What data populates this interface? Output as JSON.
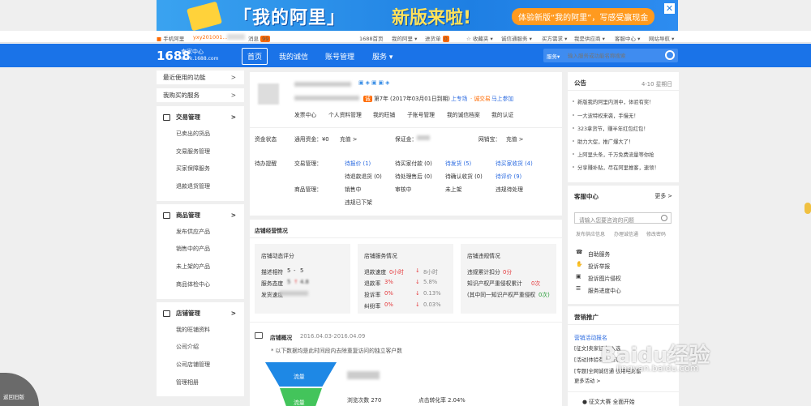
{
  "banner": {
    "title1": "「我的阿里」",
    "title2": "新版来啦!",
    "cta": "体验新版“我的阿里”，写感受赢现金",
    "close": "✕"
  },
  "topbar": {
    "mobile": "手机阿里",
    "user": "yxy201001...",
    "messages": "消息",
    "msg_count": "99",
    "links": [
      "1688首页",
      "我的阿里 ▾",
      "进货单",
      "☆ 收藏夹 ▾",
      "诚信通服务 ▾",
      "买方需求 ▾",
      "我是供应商 ▾",
      "客服中心 ▾",
      "网站导航 ▾"
    ],
    "cart_count": "0"
  },
  "nav": {
    "logo": "1688",
    "seller_center": "卖家中心",
    "domain": "work.1688.com",
    "items": [
      "首页",
      "我的诚信",
      "账号管理",
      "服务 ▾"
    ],
    "search_scope": "服务▾",
    "search_placeholder": "输入服务或功能名称搜索"
  },
  "sidebar": {
    "top_items": [
      {
        "label": "最近使用的功能"
      },
      {
        "label": "我购买的服务"
      }
    ],
    "groups": [
      {
        "title": "交易管理",
        "items": [
          "已卖出的货品",
          "交易服务管理",
          "买家保障服务",
          "退款退货管理"
        ]
      },
      {
        "title": "商品管理",
        "items": [
          "发布供应产品",
          "销售中的产品",
          "未上架的产品",
          "商品体检中心"
        ]
      },
      {
        "title": "店铺管理",
        "items": [
          "我的旺铺资料",
          "公司介绍",
          "公司店铺管理",
          "管理相册"
        ]
      }
    ]
  },
  "profile": {
    "years": "第7年 (2017年03月01日到期)",
    "upgrade": "上专场",
    "trade": "· 诚交易",
    "join": "马上参加",
    "links": [
      "发票中心",
      "个人资料管理",
      "我的旺铺",
      "子账号管理",
      "我的诚信档案",
      "我的认证"
    ]
  },
  "funds": {
    "label": "资金状态",
    "tongyong": "通用资金：¥0",
    "recharge": "充值 >",
    "deposit": "保证金：",
    "wangxiao": "网销宝：",
    "recharge2": "充值 >"
  },
  "todo": {
    "label": "待办提醒",
    "trade_label": "交易管理：",
    "goods_label": "商品管理：",
    "trade": [
      [
        "待报价 (1)",
        "待买家付款 (0)",
        "待发货 (5)",
        "待买家收货 (4)"
      ],
      [
        "待退款退货 (0)",
        "待处理售后 (0)",
        "待确认收货 (0)",
        "待评价 (9)"
      ]
    ],
    "goods": [
      [
        "销售中",
        "审核中",
        "未上架",
        "违规待处理"
      ],
      [
        "违规已下架"
      ]
    ]
  },
  "shop": {
    "title": "店铺经营情况",
    "dynamic": {
      "title": "店铺动态评分",
      "rows": [
        [
          "描述相符",
          "5",
          "-",
          "5"
        ],
        [
          "服务态度",
          "5",
          "↑",
          "4.8"
        ],
        [
          "发货速度",
          "",
          "",
          ""
        ]
      ]
    },
    "service": {
      "title": "店铺服务情况",
      "rows": [
        [
          "退款速度",
          "0小时",
          "↓",
          "8小时"
        ],
        [
          "退款率",
          "3%",
          "↓",
          "5.8%"
        ],
        [
          "投诉率",
          "0%",
          "↓",
          "0.13%"
        ],
        [
          "纠纷率",
          "0%",
          "↓",
          "0.03%"
        ]
      ]
    },
    "violation": {
      "title": "店铺违规情况",
      "rows": [
        [
          "违规累计扣分",
          "0分"
        ],
        [
          "知识产权严重侵权累计",
          "0次"
        ],
        [
          "(其中同一知识产权严重侵权",
          "0次)"
        ]
      ]
    },
    "overview_title": "店铺概况",
    "overview_range": "2016.04.03-2016.04.09",
    "overview_note": "* 以下数据均是此时间段内去除重复访问的独立客户数",
    "funnel_top": "流量",
    "funnel_bottom": "流量",
    "views": "浏览次数 270",
    "click_rate": "点击转化率 2.04%"
  },
  "announce": {
    "title": "公告",
    "date": "4-10 星期日",
    "items": [
      "新版我的阿里内测中，体验有奖！",
      "一大波特权来袭，手慢无！",
      "323拿货节，赚半年红包红包！",
      "助力大促，推广爆大了！",
      "上阿里头条，千万免费流量等你抢",
      "分享赚补贴，尽在阿里推客，速领！"
    ]
  },
  "service": {
    "title": "客服中心",
    "more": "更多 >",
    "search_placeholder": "请输入您要咨询的问题",
    "tags": [
      "发布供应信息",
      "办理诚信通",
      "修改密码"
    ],
    "items": [
      "自助服务",
      "投诉举报",
      "投诉图片侵权",
      "服务进度中心"
    ]
  },
  "promo": {
    "title": "营销推广",
    "sub": "营销活动报名",
    "items": [
      "[征文]卖家征文 入选",
      "[活动]体验有礼 新功",
      "[专题]全网诚信通 很用电财富"
    ],
    "more": "更多活动 >",
    "contest": "征文大赛 全面开始"
  },
  "oldversion": "返回旧版",
  "watermark": "Baidu经验",
  "watermark2": "jingyan.baidu.com",
  "colors": {
    "brand": "#1a73e8",
    "accent": "#ff6a00",
    "red": "#e4393c"
  }
}
